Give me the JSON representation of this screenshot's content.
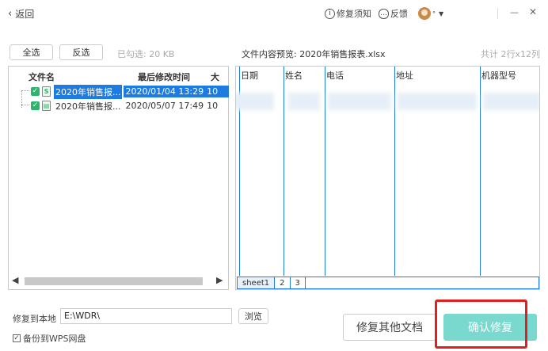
{
  "header": {
    "back_label": "返回",
    "help_label": "修复须知",
    "feedback_label": "反馈",
    "minimize_glyph": "—",
    "close_glyph": "✕"
  },
  "toolbar": {
    "select_all": "全选",
    "invert": "反选",
    "checked_info": "已勾选: 20 KB",
    "preview_title": "文件内容预览: 2020年销售报表.xlsx",
    "total_info": "共计 2行x12列"
  },
  "file_list": {
    "columns": [
      "文件名",
      "最后修改时间",
      "大"
    ],
    "rows": [
      {
        "name": "2020年销售报...",
        "time": "2020/01/04 13:29",
        "size": "10"
      },
      {
        "name": "2020年销售报...",
        "time": "2020/05/07 17:49",
        "size": "10"
      }
    ]
  },
  "preview": {
    "columns": [
      "日期",
      "姓名",
      "电话",
      "地址",
      "机器型号"
    ],
    "sheets": [
      "sheet1",
      "2",
      "3"
    ]
  },
  "bottom": {
    "restore_label": "修复到本地",
    "restore_path": "E:\\WDR\\",
    "browse": "浏览",
    "backup_label": "备份到WPS网盘",
    "repair_other": "修复其他文档",
    "confirm": "确认修复"
  },
  "colors": {
    "accent_blue": "#1e7be0",
    "checkbox_green": "#2db56e",
    "confirm_teal": "#7ad9cf",
    "highlight_red": "#e02020"
  }
}
